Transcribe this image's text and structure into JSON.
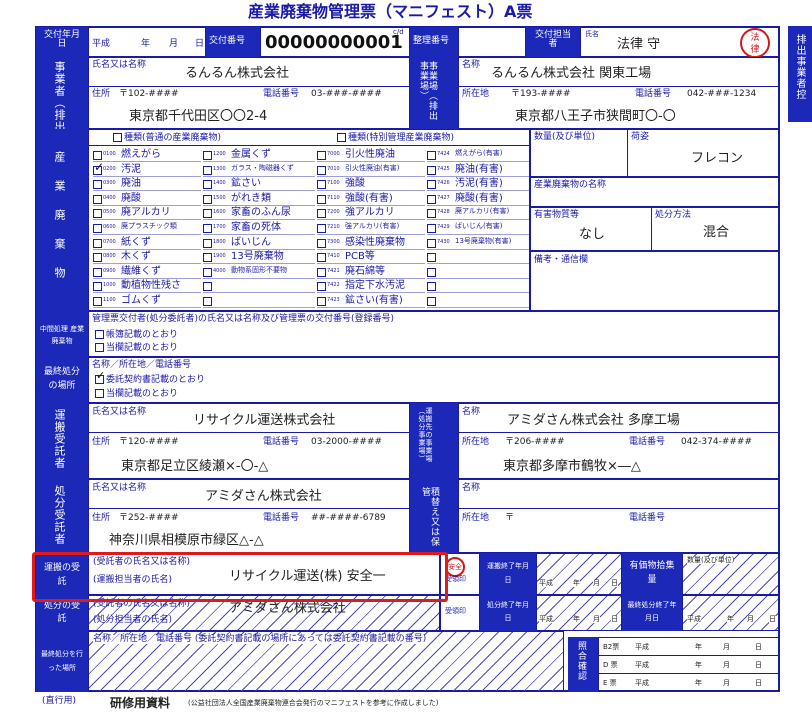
{
  "title": "産業廃棄物管理票（マニフェスト）A票",
  "side_tab": "排出事業者控",
  "header": {
    "issue_date_label": "交付年月日",
    "era": "平成",
    "year": "年",
    "month": "月",
    "day": "日",
    "issue_no_label": "交付番号",
    "issue_no": "00000000001",
    "issue_no_check": "1",
    "cd": "c/d",
    "ref_no_label": "整理番号",
    "person_label": "交付担当者",
    "name_label": "氏名",
    "person_name": "法律 守",
    "stamp": "法律"
  },
  "emitter": {
    "label": "事業者（排出者）",
    "name_label": "氏名又は名称",
    "name": "るんるん株式会社",
    "address_label": "住所",
    "zip": "〒102-####",
    "phone_label": "電話番号",
    "phone": "03-###-####",
    "address": "東京都千代田区〇〇2-4"
  },
  "site": {
    "label": "事業場（排出事業場）",
    "name_label": "名称",
    "name": "るんるん株式会社 関東工場",
    "address_label": "所在地",
    "zip": "〒193-####",
    "phone_label": "電話番号",
    "phone": "042-###-1234",
    "address": "東京都八王子市狭間町〇-〇"
  },
  "waste": {
    "label": "産業廃棄物",
    "type_normal": "種類(普通の産業廃棄物)",
    "type_special": "種類(特別管理産業廃棄物)",
    "col1": [
      {
        "code": "0100",
        "name": "燃えがら"
      },
      {
        "code": "0200",
        "name": "汚泥",
        "checked": true
      },
      {
        "code": "0300",
        "name": "廃油"
      },
      {
        "code": "0400",
        "name": "廃酸"
      },
      {
        "code": "0500",
        "name": "廃アルカリ"
      },
      {
        "code": "0600",
        "name": "廃プラスチック類"
      },
      {
        "code": "0700",
        "name": "紙くず"
      },
      {
        "code": "0800",
        "name": "木くず"
      },
      {
        "code": "0900",
        "name": "繊維くず"
      },
      {
        "code": "1000",
        "name": "動植物性残さ"
      },
      {
        "code": "1100",
        "name": "ゴムくず"
      }
    ],
    "col2": [
      {
        "code": "1200",
        "name": "金属くず"
      },
      {
        "code": "1300",
        "name": "ガラス・陶磁器くず"
      },
      {
        "code": "1400",
        "name": "鉱さい"
      },
      {
        "code": "1500",
        "name": "がれき類"
      },
      {
        "code": "1600",
        "name": "家畜のふん尿"
      },
      {
        "code": "1700",
        "name": "家畜の死体"
      },
      {
        "code": "1800",
        "name": "ばいじん"
      },
      {
        "code": "1900",
        "name": "13号廃棄物"
      },
      {
        "code": "4000",
        "name": "動物系固形不要物"
      },
      {
        "code": "",
        "name": ""
      },
      {
        "code": "",
        "name": ""
      }
    ],
    "col3": [
      {
        "code": "7000",
        "name": "引火性廃油"
      },
      {
        "code": "7010",
        "name": "引火性廃油(有害)"
      },
      {
        "code": "7100",
        "name": "強酸"
      },
      {
        "code": "7110",
        "name": "強酸(有害)"
      },
      {
        "code": "7200",
        "name": "強アルカリ"
      },
      {
        "code": "7210",
        "name": "強アルカリ(有害)"
      },
      {
        "code": "7300",
        "name": "感染性廃棄物"
      },
      {
        "code": "7410",
        "name": "PCB等"
      },
      {
        "code": "7421",
        "name": "廃石綿等"
      },
      {
        "code": "7422",
        "name": "指定下水汚泥"
      },
      {
        "code": "7423",
        "name": "鉱さい(有害)"
      }
    ],
    "col4": [
      {
        "code": "7424",
        "name": "燃えがら(有害)"
      },
      {
        "code": "7425",
        "name": "廃油(有害)"
      },
      {
        "code": "7426",
        "name": "汚泥(有害)"
      },
      {
        "code": "7427",
        "name": "廃酸(有害)"
      },
      {
        "code": "7428",
        "name": "廃アルカリ(有害)"
      },
      {
        "code": "7429",
        "name": "ばいじん(有害)"
      },
      {
        "code": "7430",
        "name": "13号廃棄物(有害)"
      },
      {
        "code": "",
        "name": ""
      },
      {
        "code": "",
        "name": ""
      },
      {
        "code": "",
        "name": ""
      },
      {
        "code": "",
        "name": ""
      }
    ],
    "qty_label": "数量(及び単位)",
    "shape_label": "荷姿",
    "shape": "フレコン",
    "name_label": "産業廃棄物の名称",
    "hazard_label": "有害物質等",
    "hazard": "なし",
    "method_label": "処分方法",
    "method": "混合",
    "remarks_label": "備考・通信欄"
  },
  "intermediate": {
    "label": "中間処理 産業廃棄物",
    "text": "管理票交付者(処分委託者)の氏名又は名称及び管理票の交付番号(登録番号)",
    "opt1": "帳簿記載のとおり",
    "opt2": "当欄記載のとおり"
  },
  "final_site": {
    "label": "最終処分の場所",
    "text": "名称／所在地／電話番号",
    "opt1": "委託契約書記載のとおり",
    "opt2": "当欄記載のとおり"
  },
  "transport_contractor": {
    "label": "運搬受託者",
    "name_label": "氏名又は名称",
    "name": "リサイクル運送株式会社",
    "address_label": "住所",
    "zip": "〒120-####",
    "phone_label": "電話番号",
    "phone": "03-2000-####",
    "address": "東京都足立区綾瀬×-〇-△"
  },
  "transport_dest": {
    "label": "運搬先の事業場（処分事業場）",
    "name_label": "名称",
    "name": "アミダさん株式会社 多摩工場",
    "address_label": "所在地",
    "zip": "〒206-####",
    "phone_label": "電話番号",
    "phone": "042-374-####",
    "address": "東京都多摩市鶴牧×―△"
  },
  "disposal_contractor": {
    "label": "処分受託者",
    "name_label": "氏名又は名称",
    "name": "アミダさん株式会社",
    "address_label": "住所",
    "zip": "〒252-####",
    "phone_label": "電話番号",
    "phone": "##-####-6789",
    "address": "神奈川県相模原市緑区△-△"
  },
  "transfer": {
    "label": "積替え又は保管",
    "name_label": "名称",
    "address_label": "所在地",
    "zip": "〒",
    "phone_label": "電話番号"
  },
  "transport_receipt": {
    "label": "運搬の受託",
    "line1": "(受託者の氏名又は名称)",
    "line2": "(運搬担当者の氏名)",
    "value": "リサイクル運送(株) 安全一",
    "stamp": "安全",
    "seal_label": "受領印",
    "done_label": "運搬終了年月日",
    "era": "平成",
    "year": "年",
    "month": "月",
    "day": "日",
    "valuables_label": "有価物拾集量",
    "qty_label": "数量(及び単位)"
  },
  "disposal_receipt": {
    "label": "処分の受託",
    "line1": "(受託者の氏名又は名称)",
    "line2": "(処分担当者の氏名)",
    "value": "アミダさん株式会社",
    "seal_label": "受領印",
    "done_label": "処分終了年月日",
    "final_label": "最終処分終了年月日",
    "era": "平成",
    "year": "年",
    "month": "月",
    "day": "日"
  },
  "final_place": {
    "label": "最終処分を行った場所",
    "text": "名称／所在地／電話番号 (委託契約書記載の場所にあっては委託契約書記載の番号)"
  },
  "verify": {
    "label": "照合確認",
    "rows": [
      {
        "name": "B2票",
        "era": "平成",
        "y": "年",
        "m": "月",
        "d": "日"
      },
      {
        "name": "D 票",
        "era": "平成",
        "y": "年",
        "m": "月",
        "d": "日"
      },
      {
        "name": "E 票",
        "era": "平成",
        "y": "年",
        "m": "月",
        "d": "日"
      }
    ]
  },
  "footer": {
    "direct": "(直行用)",
    "training": "研修用資料",
    "note": "(公益社団法人全国産業廃棄物連合会発行のマニフェストを参考に作成しました)"
  }
}
